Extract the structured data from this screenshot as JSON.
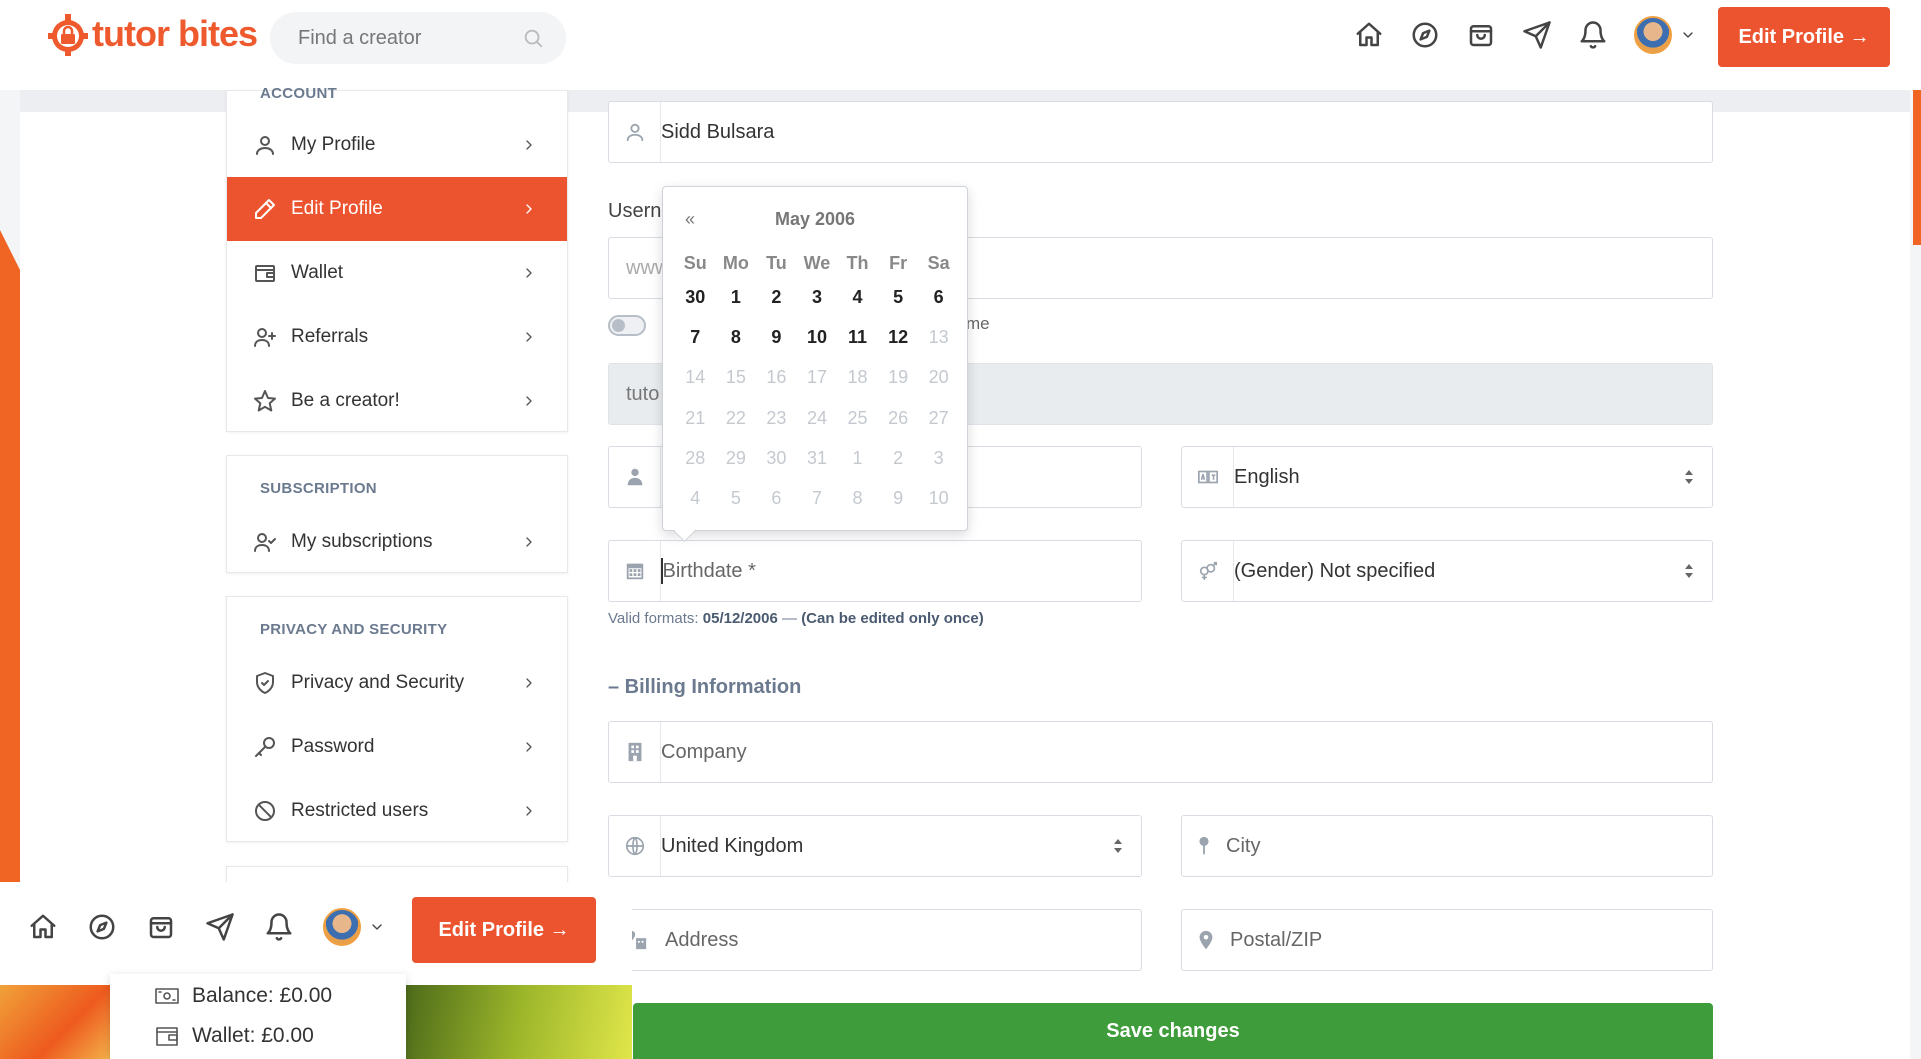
{
  "brand": {
    "name": "tutor bites",
    "color": "#ec5430"
  },
  "header": {
    "search_placeholder": "Find a creator",
    "nav_icons": [
      "home-icon",
      "compass-icon",
      "shopping-bag-icon",
      "send-icon",
      "bell-icon"
    ],
    "cta_label": "Edit Profile →"
  },
  "sidebar": {
    "account": {
      "title": "ACCOUNT",
      "items": [
        {
          "label": "My Profile",
          "icon": "user-icon"
        },
        {
          "label": "Edit Profile",
          "icon": "pencil-icon",
          "active": true
        },
        {
          "label": "Wallet",
          "icon": "wallet-icon"
        },
        {
          "label": "Referrals",
          "icon": "user-plus-icon"
        },
        {
          "label": "Be a creator!",
          "icon": "star-icon"
        }
      ]
    },
    "subscription": {
      "title": "SUBSCRIPTION",
      "items": [
        {
          "label": "My subscriptions",
          "icon": "user-check-icon"
        }
      ]
    },
    "privacy": {
      "title": "PRIVACY AND SECURITY",
      "items": [
        {
          "label": "Privacy and Security",
          "icon": "shield-icon"
        },
        {
          "label": "Password",
          "icon": "key-icon"
        },
        {
          "label": "Restricted users",
          "icon": "ban-icon"
        }
      ]
    }
  },
  "form": {
    "name_value": "Sidd Bulsara",
    "username_label": "Usern",
    "website_placeholder": "www",
    "toggle_note": "me",
    "disabled_value": "tuto",
    "language_value": "English",
    "birthdate_placeholder": "Birthdate *",
    "gender_value": "(Gender) Not specified",
    "hint_prefix": "Valid formats:",
    "hint_format": "05/12/2006",
    "hint_dash": "—",
    "hint_note": "(Can be edited only once)",
    "billing_title": "– Billing Information",
    "company_placeholder": "Company",
    "country_value": "United Kingdom",
    "city_placeholder": "City",
    "address_placeholder": "Address",
    "postal_placeholder": "Postal/ZIP",
    "save_label": "Save changes"
  },
  "datepicker": {
    "prev": "«",
    "title": "May 2006",
    "days_of_week": [
      "Su",
      "Mo",
      "Tu",
      "We",
      "Th",
      "Fr",
      "Sa"
    ],
    "weeks": [
      [
        {
          "d": "30",
          "s": "cur"
        },
        {
          "d": "1",
          "s": "cur"
        },
        {
          "d": "2",
          "s": "cur"
        },
        {
          "d": "3",
          "s": "cur"
        },
        {
          "d": "4",
          "s": "cur"
        },
        {
          "d": "5",
          "s": "cur"
        },
        {
          "d": "6",
          "s": "cur"
        }
      ],
      [
        {
          "d": "7",
          "s": "cur"
        },
        {
          "d": "8",
          "s": "cur"
        },
        {
          "d": "9",
          "s": "cur"
        },
        {
          "d": "10",
          "s": "cur"
        },
        {
          "d": "11",
          "s": "cur"
        },
        {
          "d": "12",
          "s": "cur"
        },
        {
          "d": "13",
          "s": "off"
        }
      ],
      [
        {
          "d": "14",
          "s": "off"
        },
        {
          "d": "15",
          "s": "off"
        },
        {
          "d": "16",
          "s": "off"
        },
        {
          "d": "17",
          "s": "off"
        },
        {
          "d": "18",
          "s": "off"
        },
        {
          "d": "19",
          "s": "off"
        },
        {
          "d": "20",
          "s": "off"
        }
      ],
      [
        {
          "d": "21",
          "s": "off"
        },
        {
          "d": "22",
          "s": "off"
        },
        {
          "d": "23",
          "s": "off"
        },
        {
          "d": "24",
          "s": "off"
        },
        {
          "d": "25",
          "s": "off"
        },
        {
          "d": "26",
          "s": "off"
        },
        {
          "d": "27",
          "s": "off"
        }
      ],
      [
        {
          "d": "28",
          "s": "off"
        },
        {
          "d": "29",
          "s": "off"
        },
        {
          "d": "30",
          "s": "off"
        },
        {
          "d": "31",
          "s": "off"
        },
        {
          "d": "1",
          "s": "off"
        },
        {
          "d": "2",
          "s": "off"
        },
        {
          "d": "3",
          "s": "off"
        }
      ],
      [
        {
          "d": "4",
          "s": "off"
        },
        {
          "d": "5",
          "s": "off"
        },
        {
          "d": "6",
          "s": "off"
        },
        {
          "d": "7",
          "s": "off"
        },
        {
          "d": "8",
          "s": "off"
        },
        {
          "d": "9",
          "s": "off"
        },
        {
          "d": "10",
          "s": "off"
        }
      ]
    ]
  },
  "overlay": {
    "cta_label": "Edit Profile →",
    "balance": "Balance: £0.00",
    "wallet": "Wallet: £0.00"
  }
}
